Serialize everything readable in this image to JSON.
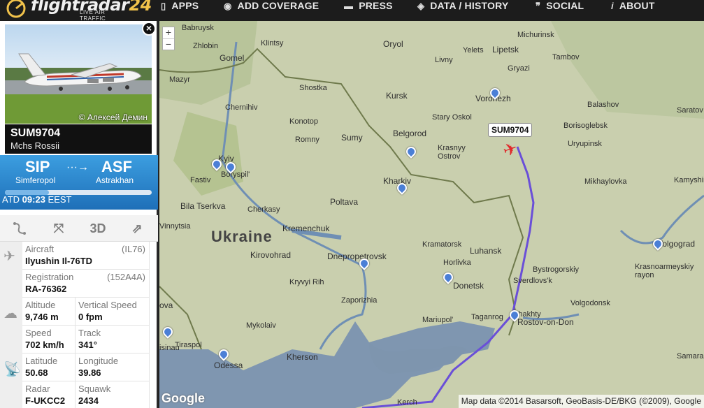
{
  "header": {
    "logo_main": "flightradar",
    "logo_num": "24",
    "logo_sub": "LIVE AIR TRAFFIC",
    "nav": [
      {
        "label": "APPS",
        "icon": "phone-icon"
      },
      {
        "label": "ADD COVERAGE",
        "icon": "eye-icon"
      },
      {
        "label": "PRESS",
        "icon": "speech-icon"
      },
      {
        "label": "DATA / HISTORY",
        "icon": "box-icon"
      },
      {
        "label": "SOCIAL",
        "icon": "quote-icon"
      },
      {
        "label": "ABOUT",
        "icon": "info-icon"
      }
    ]
  },
  "panel": {
    "close": "×",
    "photo_credit": "© Алексей Демин",
    "callsign": "SUM9704",
    "airline": "Mchs Rossii",
    "route": {
      "from_code": "SIP",
      "from_city": "Simferopol",
      "to_code": "ASF",
      "to_city": "Astrakhan",
      "progress": 0.3
    },
    "atd_label": "ATD",
    "atd_time": "09:23",
    "atd_zone": "EEST",
    "tools": {
      "three_d": "3D"
    },
    "details": {
      "aircraft_label": "Aircraft",
      "aircraft_code": "(IL76)",
      "aircraft_value": "Ilyushin Il-76TD",
      "registration_label": "Registration",
      "registration_code": "(152A4A)",
      "registration_value": "RA-76362",
      "altitude_label": "Altitude",
      "altitude_value": "9,746 m",
      "vspeed_label": "Vertical Speed",
      "vspeed_value": "0 fpm",
      "speed_label": "Speed",
      "speed_value": "702 km/h",
      "track_label": "Track",
      "track_value": "341°",
      "latitude_label": "Latitude",
      "latitude_value": "50.68",
      "longitude_label": "Longitude",
      "longitude_value": "39.86",
      "radar_label": "Radar",
      "radar_value": "F-UKCC2",
      "squawk_label": "Squawk",
      "squawk_value": "2434"
    }
  },
  "map": {
    "zoom_in": "+",
    "zoom_out": "−",
    "flight_label": "SUM9704",
    "country": "Ukraine",
    "google": "Google",
    "copyright": "Map data ©2014 Basarsoft, GeoBasis-DE/BKG (©2009), Google",
    "places": [
      "Babruysk",
      "Zhlobin",
      "Klintsy",
      "Oryol",
      "Michurinsk",
      "Yelets",
      "Lipetsk",
      "Tambov",
      "Livny",
      "Gryazi",
      "Gomel",
      "Mazyr",
      "Shostka",
      "Kursk",
      "Chernihiv",
      "Voronezh",
      "Balashov",
      "Konotop",
      "Stary Oskol",
      "Borisoglebsk",
      "Romny",
      "Sumy",
      "Belgorod",
      "Krasnyy Ostrov",
      "Uryupinsk",
      "Kyiv",
      "Fastiv",
      "Boryspil'",
      "Kharkiv",
      "Mikhaylovka",
      "Kamyshin",
      "Bila Tserkva",
      "Poltava",
      "Cherkasy",
      "Vinnytsia",
      "Kremenchuk",
      "Kirovohrad",
      "Kramatorsk",
      "Luhansk",
      "Volgograd",
      "Dnepropetrovsk",
      "Horlivka",
      "Bystrogorskiy",
      "Krasnoarmeyskiy rayon",
      "Kryvyi Rih",
      "Donetsk",
      "Sverdlovs'k",
      "Zaporizhia",
      "Shakhty",
      "Volgodonsk",
      "Mariupol'",
      "Taganrog",
      "Rostov-on-Don",
      "Mykolaiv",
      "Tiraspol",
      "Kherson",
      "Odessa",
      "Kerch",
      "Saratov",
      "Samara",
      "ova",
      "isinau"
    ]
  }
}
